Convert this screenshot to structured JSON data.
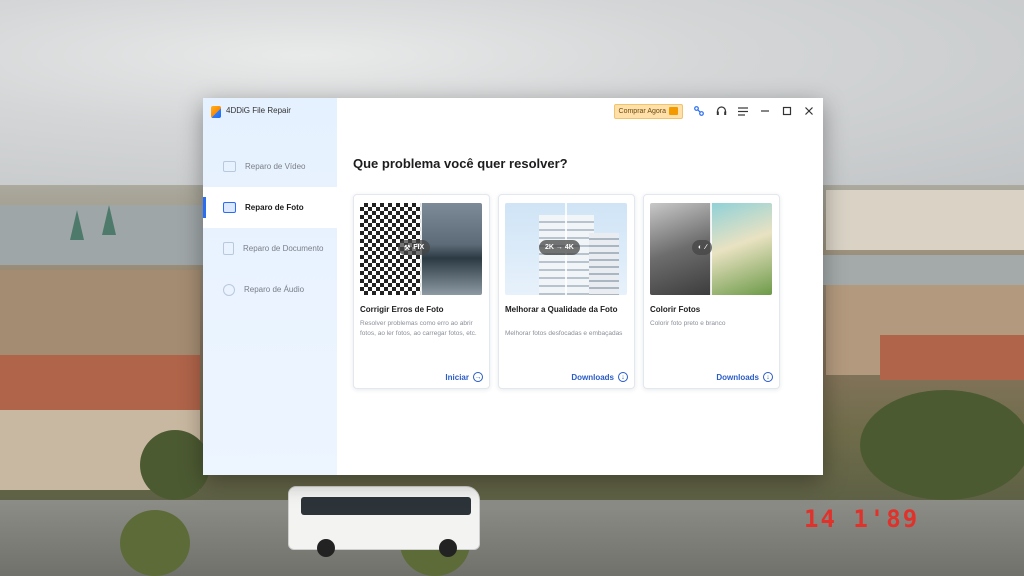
{
  "app": {
    "title": "4DDiG File Repair"
  },
  "toolbar": {
    "buy_label": "Comprar Agora"
  },
  "sidebar": {
    "items": [
      {
        "label": "Reparo de Vídeo",
        "icon": "video-icon",
        "active": false
      },
      {
        "label": "Reparo de Foto",
        "icon": "photo-icon",
        "active": true
      },
      {
        "label": "Reparo de Documento",
        "icon": "document-icon",
        "active": false
      },
      {
        "label": "Reparo de Áudio",
        "icon": "audio-icon",
        "active": false
      }
    ]
  },
  "main": {
    "headline": "Que problema você quer resolver?",
    "cards": [
      {
        "badge": "FIX",
        "title": "Corrigir Erros de Foto",
        "description": "Resolver problemas como erro ao abrir fotos, ao ler fotos, ao carregar fotos, etc.",
        "action": "Iniciar",
        "action_icon": "arrow-right-icon"
      },
      {
        "badge": "2K → 4K",
        "title": "Melhorar a Qualidade da Foto",
        "description": "Melhorar fotos desfocadas e embaçadas",
        "action": "Downloads",
        "action_icon": "download-icon"
      },
      {
        "badge": "",
        "title": "Colorir Fotos",
        "description": "Colorir foto preto e branco",
        "action": "Downloads",
        "action_icon": "download-icon"
      }
    ]
  },
  "background": {
    "clock_text": "14 1'89"
  },
  "colors": {
    "accent": "#2a6df5",
    "link": "#2a5cc7",
    "buy_bg": "#ffe0a8",
    "sidebar_bg": "#e6f1ff"
  }
}
